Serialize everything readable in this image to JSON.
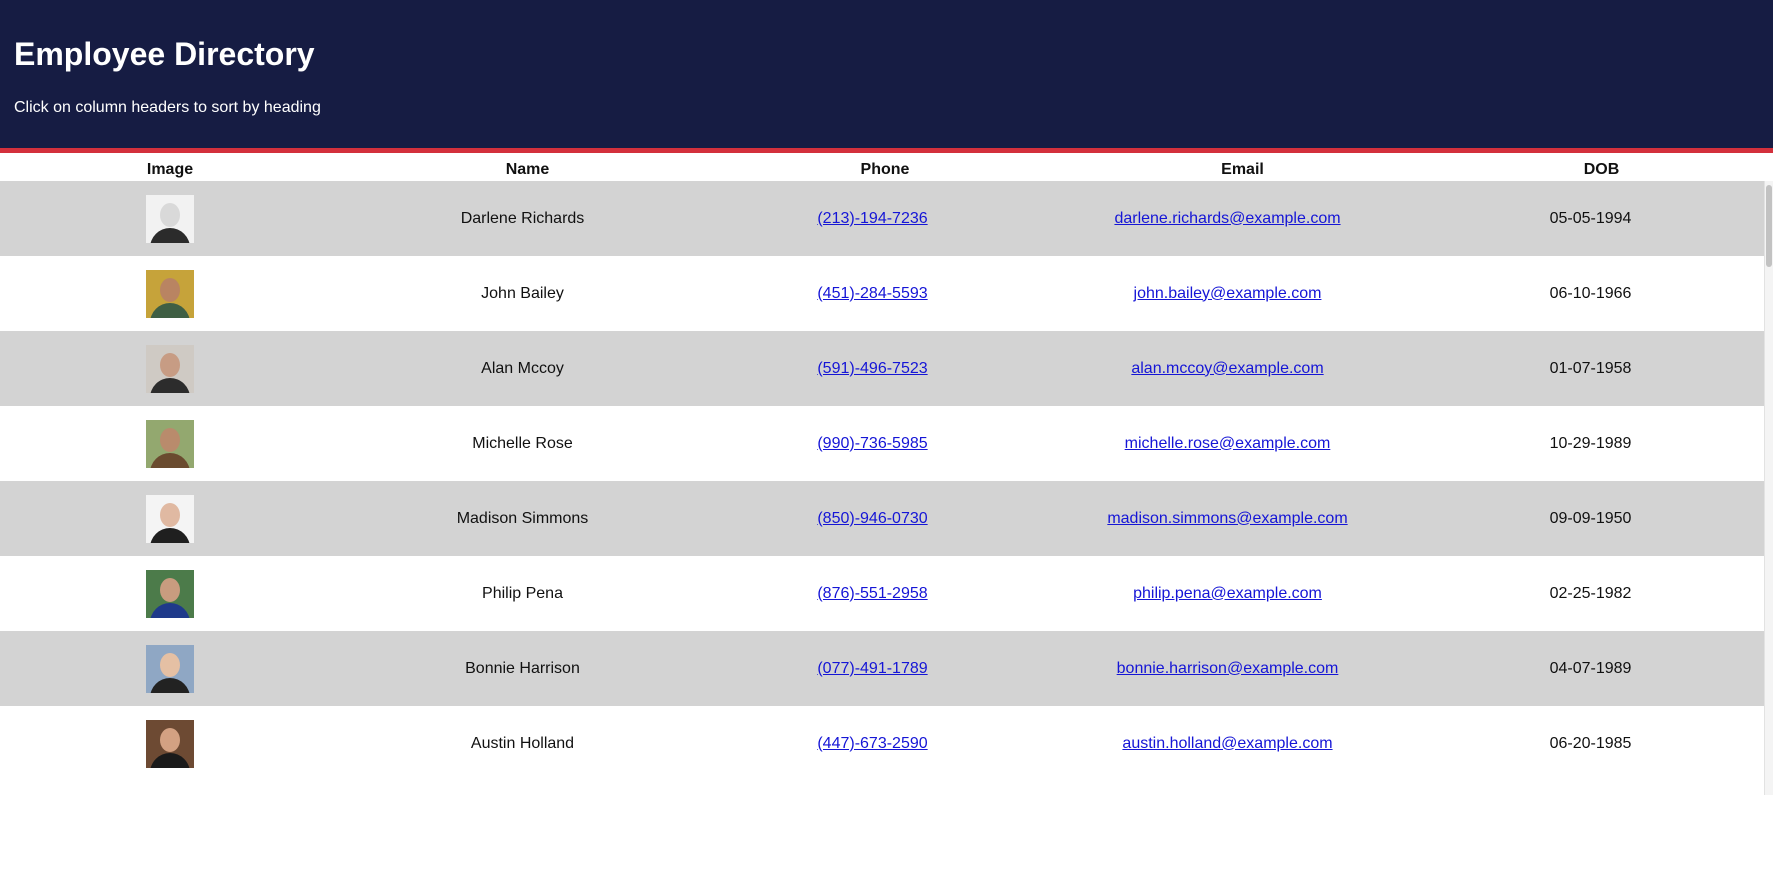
{
  "header": {
    "title": "Employee Directory",
    "subtitle": "Click on column headers to sort by heading"
  },
  "columns": [
    "Image",
    "Name",
    "Phone",
    "Email",
    "DOB"
  ],
  "employees": [
    {
      "name": "Darlene Richards",
      "phone": "(213)-194-7236",
      "email": "darlene.richards@example.com",
      "dob": "05-05-1994",
      "photo": {
        "bg": "#f2f2f2",
        "skin": "#d9d9d9",
        "shirt": "#2b2b2b"
      }
    },
    {
      "name": "John Bailey",
      "phone": "(451)-284-5593",
      "email": "john.bailey@example.com",
      "dob": "06-10-1966",
      "photo": {
        "bg": "#c6a33a",
        "skin": "#b98462",
        "shirt": "#3f5f44"
      }
    },
    {
      "name": "Alan Mccoy",
      "phone": "(591)-496-7523",
      "email": "alan.mccoy@example.com",
      "dob": "01-07-1958",
      "photo": {
        "bg": "#cfcac4",
        "skin": "#c79c84",
        "shirt": "#2c2c2c"
      }
    },
    {
      "name": "Michelle Rose",
      "phone": "(990)-736-5985",
      "email": "michelle.rose@example.com",
      "dob": "10-29-1989",
      "photo": {
        "bg": "#93a86f",
        "skin": "#b98b6c",
        "shirt": "#6a4b2f"
      }
    },
    {
      "name": "Madison Simmons",
      "phone": "(850)-946-0730",
      "email": "madison.simmons@example.com",
      "dob": "09-09-1950",
      "photo": {
        "bg": "#f4f4f4",
        "skin": "#e0b9a2",
        "shirt": "#1f1f1f"
      }
    },
    {
      "name": "Philip Pena",
      "phone": "(876)-551-2958",
      "email": "philip.pena@example.com",
      "dob": "02-25-1982",
      "photo": {
        "bg": "#4c7b4a",
        "skin": "#c89c7f",
        "shirt": "#1f3a8a"
      }
    },
    {
      "name": "Bonnie Harrison",
      "phone": "(077)-491-1789",
      "email": "bonnie.harrison@example.com",
      "dob": "04-07-1989",
      "photo": {
        "bg": "#8fa7c4",
        "skin": "#e5c0a4",
        "shirt": "#222222"
      }
    },
    {
      "name": "Austin Holland",
      "phone": "(447)-673-2590",
      "email": "austin.holland@example.com",
      "dob": "06-20-1985",
      "photo": {
        "bg": "#6d4a33",
        "skin": "#d3a182",
        "shirt": "#1a1a1a"
      }
    }
  ]
}
